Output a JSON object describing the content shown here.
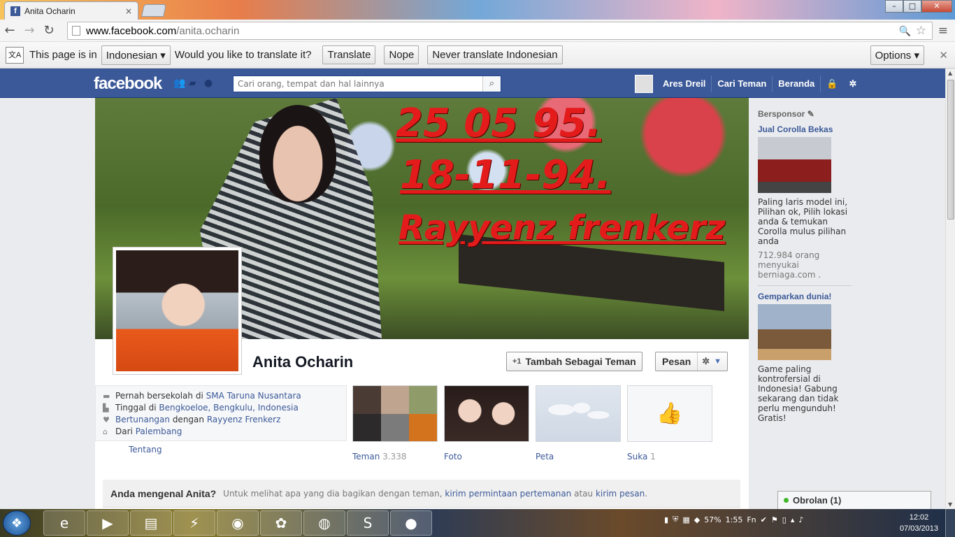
{
  "browser": {
    "tab_title": "Anita Ocharin",
    "tab_favicon": "f",
    "tab_close": "×",
    "url_host": "www.facebook.com",
    "url_path": "/anita.ocharin",
    "window_buttons": {
      "minimize": "–",
      "maximize": "□",
      "close": "✕"
    }
  },
  "translate_bar": {
    "icon_text": "文A",
    "prefix": "This page is in",
    "language": "Indonesian ▾",
    "question": "Would you like to translate it?",
    "translate_btn": "Translate",
    "nope_btn": "Nope",
    "never_btn": "Never translate Indonesian",
    "options_btn": "Options ▾",
    "close": "✕"
  },
  "fb": {
    "logo": "facebook",
    "search_placeholder": "Cari orang, tempat dan hal lainnya",
    "user_name": "Ares Dreil",
    "nav_find_friends": "Cari Teman",
    "nav_home": "Beranda"
  },
  "profile": {
    "cover_line1": "25 05 95.",
    "cover_line2": "18-11-94.",
    "cover_line3": "Rayyenz frenkerz",
    "name": "Anita Ocharin",
    "add_friend": "Tambah Sebagai Teman",
    "add_friend_icon": "+1",
    "message": "Pesan",
    "info": [
      {
        "icon": "school-icon",
        "glyph": "▬",
        "text": "Pernah bersekolah di ",
        "link": "SMA Taruna Nusantara"
      },
      {
        "icon": "home-icon",
        "glyph": "▙",
        "text": "Tinggal di ",
        "link": "Bengkoeloe, Bengkulu, Indonesia"
      },
      {
        "icon": "heart-icon",
        "glyph": "♥",
        "pre_link": "Bertunangan",
        "text": " dengan ",
        "link": "Rayyenz Frenkerz"
      },
      {
        "icon": "hometown-icon",
        "glyph": "⌂",
        "text": "Dari ",
        "link": "Palembang"
      }
    ],
    "about_link": "Tentang",
    "tiles": [
      {
        "name": "friends",
        "label": "Teman",
        "count": "3.338"
      },
      {
        "name": "photos",
        "label": "Foto",
        "count": ""
      },
      {
        "name": "map",
        "label": "Peta",
        "count": ""
      },
      {
        "name": "likes",
        "label": "Suka",
        "count": "1"
      }
    ],
    "know_question": "Anda mengenal Anita?",
    "know_text": "Untuk melihat apa yang dia bagikan dengan teman,",
    "know_link1": "kirim permintaan pertemanan",
    "know_mid": "atau",
    "know_link2": "kirim pesan",
    "know_end": "."
  },
  "sidebar": {
    "header": "Bersponsor",
    "ads": [
      {
        "title": "Jual Corolla Bekas",
        "desc": "Paling laris model ini, Pilihan ok, Pilih lokasi anda & temukan Corolla mulus pilihan anda",
        "meta": "712.984 orang menyukai berniaga.com ."
      },
      {
        "title": "Gemparkan dunia!",
        "desc": "Game paling kontrofersial di Indonesia! Gabung sekarang dan tidak perlu mengunduh! Gratis!",
        "meta": ""
      }
    ],
    "chat": "Obrolan (1)"
  },
  "taskbar": {
    "tray_battery": "57%",
    "tray_time_small": "1:55",
    "tray_fn": "Fn",
    "time": "12:02",
    "date": "07/03/2013"
  }
}
